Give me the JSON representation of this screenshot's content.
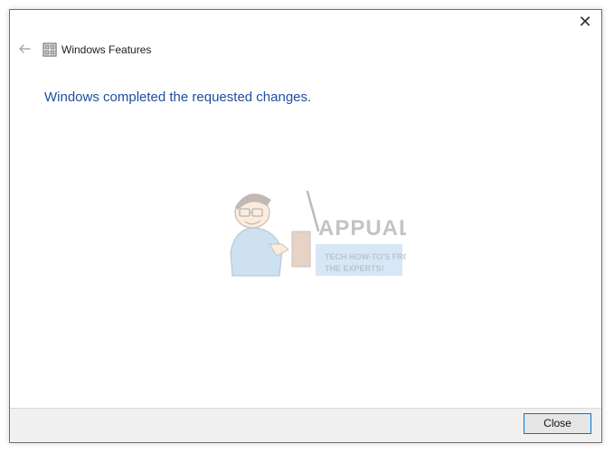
{
  "window": {
    "title": "Windows Features",
    "close_glyph": "✕"
  },
  "content": {
    "message": "Windows completed the requested changes."
  },
  "footer": {
    "close_label": "Close"
  },
  "watermark": {
    "brand": "APPUALS",
    "tagline_line1": "TECH HOW-TO'S FROM",
    "tagline_line2": "THE EXPERTS!"
  },
  "icons": {
    "back": "back-arrow-icon",
    "app": "windows-features-icon",
    "close": "close-icon"
  },
  "colors": {
    "message_text": "#1f4ea1",
    "footer_bg": "#f0f0f0",
    "button_border": "#0078d7"
  }
}
